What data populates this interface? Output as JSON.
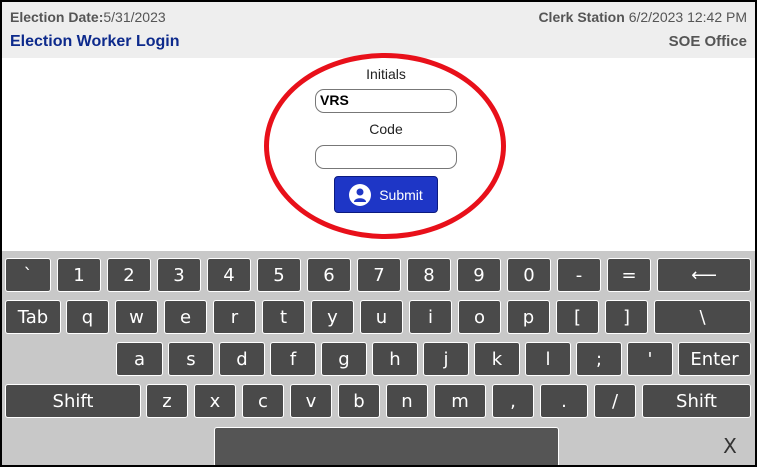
{
  "header": {
    "election_date_label": "Election Date:",
    "election_date_value": "5/31/2023",
    "screen_title": "Election Worker Login",
    "station_label": "Clerk Station",
    "station_datetime": "6/2/2023 12:42 PM",
    "office": "SOE Office"
  },
  "form": {
    "initials_label": "Initials",
    "initials_value": "VRS",
    "code_label": "Code",
    "code_value": "",
    "submit_label": "Submit",
    "submit_icon": "user-icon"
  },
  "colors": {
    "title_blue": "#0d2a8c",
    "submit_blue": "#1e36c6",
    "highlight_red": "#e8101a",
    "key_dark": "#4a4a4a"
  },
  "keyboard": {
    "row1": [
      "`",
      "1",
      "2",
      "3",
      "4",
      "5",
      "6",
      "7",
      "8",
      "9",
      "0",
      "-",
      "=",
      "⟵"
    ],
    "row2": [
      "Tab",
      "q",
      "w",
      "e",
      "r",
      "t",
      "y",
      "u",
      "i",
      "o",
      "p",
      "[",
      "]",
      "\\"
    ],
    "row3": [
      "a",
      "s",
      "d",
      "f",
      "g",
      "h",
      "j",
      "k",
      "l",
      ";",
      "'",
      "Enter"
    ],
    "row4": [
      "Shift",
      "z",
      "x",
      "c",
      "v",
      "b",
      "n",
      "m",
      ",",
      ".",
      "/",
      "Shift"
    ],
    "row5": [
      "",
      "X"
    ]
  }
}
